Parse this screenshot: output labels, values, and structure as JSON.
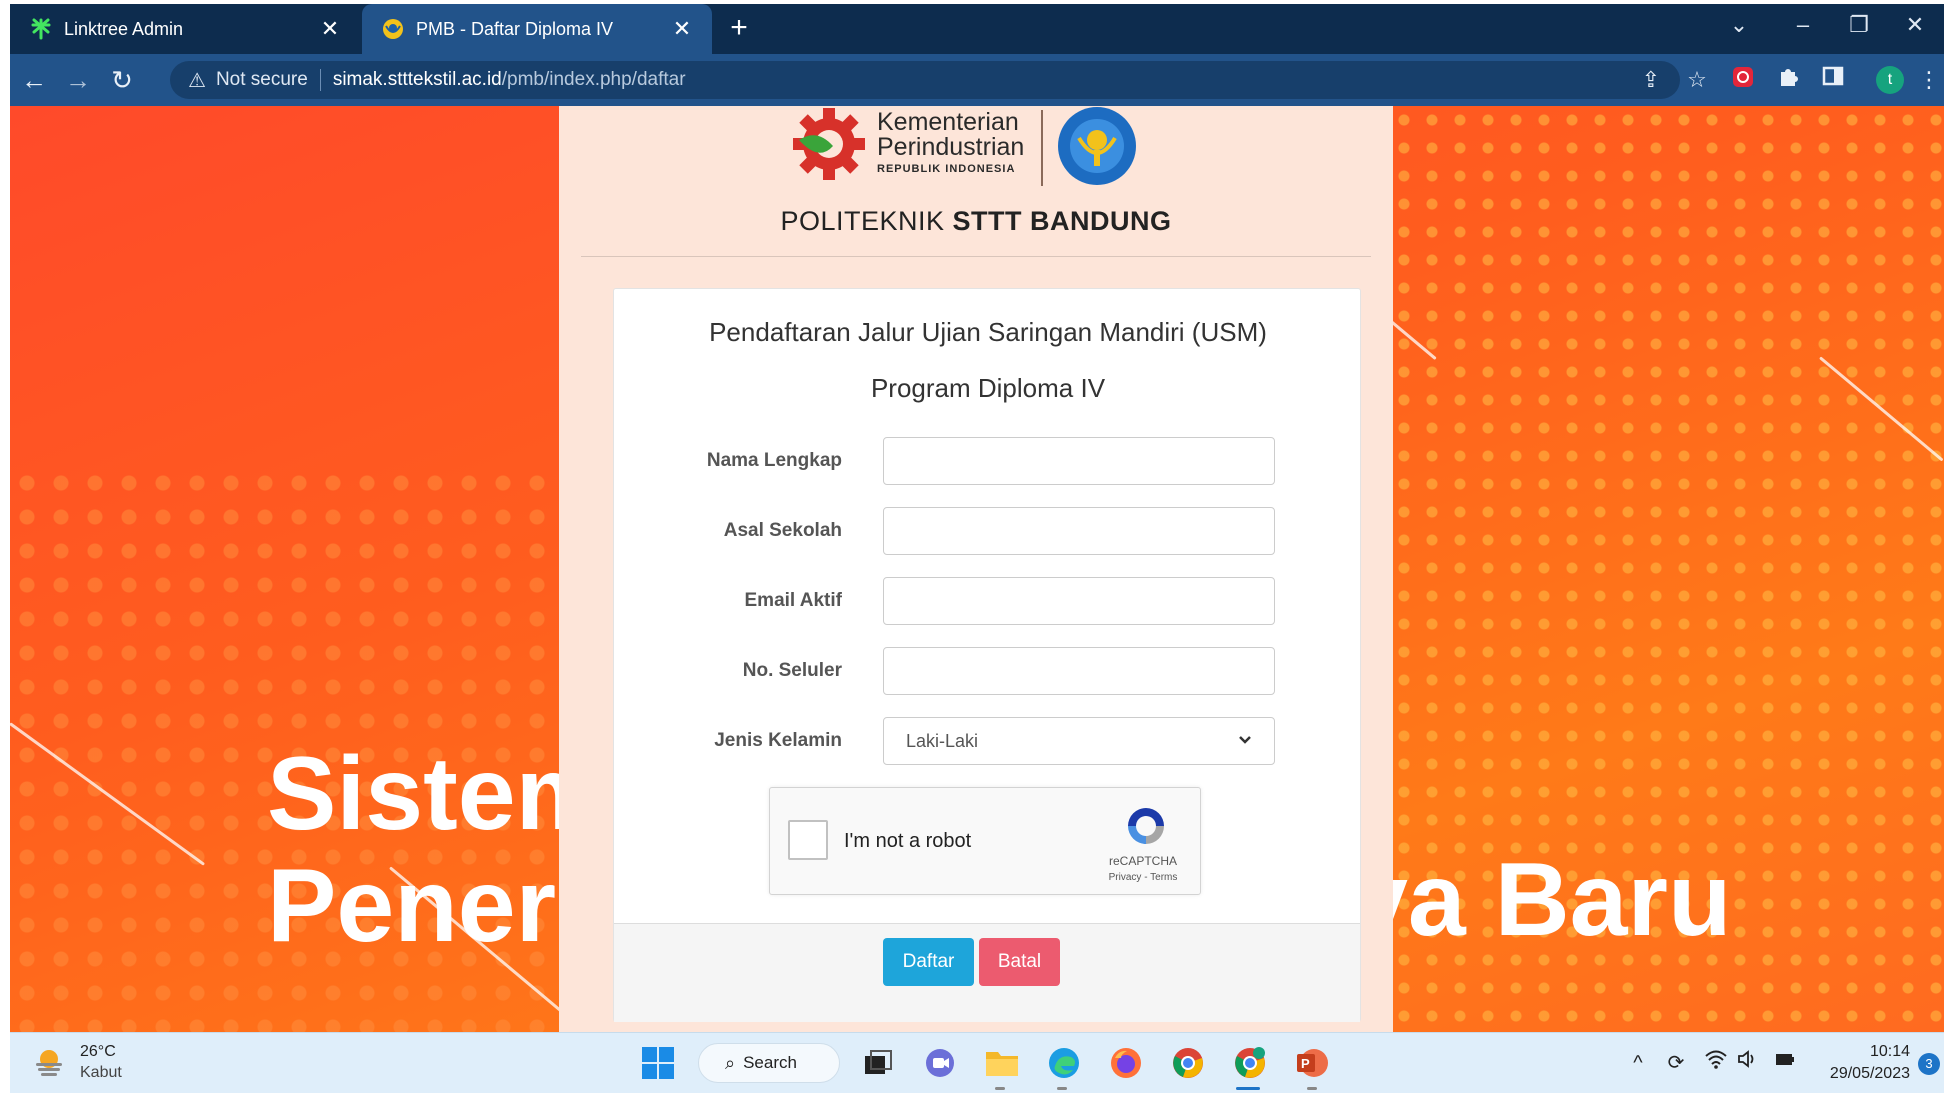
{
  "browser": {
    "tabs": [
      {
        "title": "Linktree Admin",
        "active": false,
        "favicon": "linktree-icon"
      },
      {
        "title": "PMB - Daftar Diploma IV",
        "active": true,
        "favicon": "sttt-favicon"
      }
    ],
    "new_tab_label": "+",
    "security_label": "Not secure",
    "url_host": "simak.stttekstil.ac.id",
    "url_path": "/pmb/index.php/daftar",
    "profile_initial": "t"
  },
  "page": {
    "ministry_line1": "Kementerian",
    "ministry_line2": "Perindustrian",
    "ministry_line3": "REPUBLIK INDONESIA",
    "institution_prefix": "POLITEKNIK ",
    "institution_name": "STTT BANDUNG",
    "banner_line1": "Sistem",
    "banner_line2": "Peneri",
    "banner_right": "va Baru",
    "form": {
      "title": "Pendaftaran Jalur Ujian Saringan Mandiri (USM)",
      "subtitle": "Program Diploma IV",
      "fields": [
        {
          "label": "Nama Lengkap",
          "value": ""
        },
        {
          "label": "Asal Sekolah",
          "value": ""
        },
        {
          "label": "Email Aktif",
          "value": ""
        },
        {
          "label": "No. Seluler",
          "value": ""
        }
      ],
      "gender_label": "Jenis Kelamin",
      "gender_selected": "Laki-Laki",
      "recaptcha_label": "I'm not a robot",
      "recaptcha_brand": "reCAPTCHA",
      "recaptcha_links": "Privacy - Terms",
      "submit_label": "Daftar",
      "cancel_label": "Batal"
    }
  },
  "taskbar": {
    "temperature": "26°C",
    "weather": "Kabut",
    "search_label": "Search",
    "time": "10:14",
    "date": "29/05/2023",
    "notification_count": "3"
  },
  "colors": {
    "tab_strip": "#0d2c4e",
    "toolbar": "#22538a",
    "submit": "#1ea5da",
    "cancel": "#ec5b6f",
    "background_orange": "#ff5d1e"
  }
}
